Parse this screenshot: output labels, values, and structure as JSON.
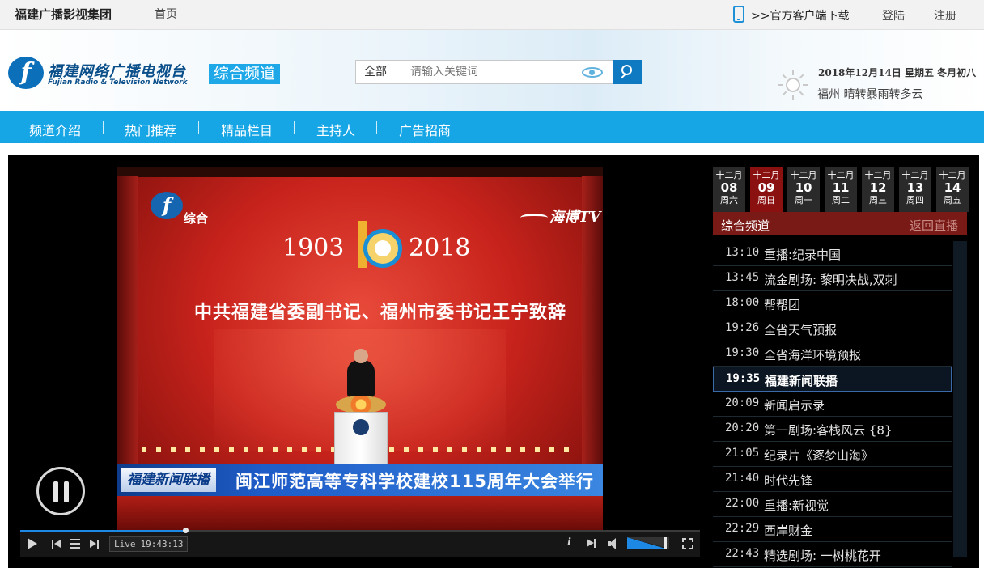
{
  "topbar": {
    "group_name": "福建广播影视集团",
    "home": "首页",
    "download": ">>官方客户端下载",
    "login": "登陆",
    "register": "注册"
  },
  "header": {
    "logo_letter": "f",
    "logo_cn": "福建网络广播电视台",
    "logo_en": "Fujian Radio & Television Network",
    "channel_tag": "综合频道",
    "search": {
      "category": "全部",
      "placeholder": "请输入关键词"
    },
    "date": "2018年12月14日  星期五  冬月初八",
    "weather": "福州 晴转暴雨转多云"
  },
  "nav": {
    "items": [
      "频道介绍",
      "热门推荐",
      "精品栏目",
      "主持人",
      "广告招商"
    ]
  },
  "video": {
    "channel_logo_letter": "f",
    "channel_name": "综合",
    "watermark": "海博TV",
    "year_start": "1903",
    "year_end": "2018",
    "headline": "中共福建省委副书记、福州市委书记王宁致辞",
    "program_tag": "福建新闻联播",
    "news_ticker": "闽江师范高等专科学校建校115周年大会举行"
  },
  "controls": {
    "live_label": "Live",
    "live_time": "19:43:13",
    "info_label": "i",
    "progress": 0.243,
    "volume": 0.92
  },
  "schedule": {
    "days": [
      {
        "month": "十二月",
        "day": "08",
        "weekday": "周六",
        "active": false
      },
      {
        "month": "十二月",
        "day": "09",
        "weekday": "周日",
        "active": true
      },
      {
        "month": "十二月",
        "day": "10",
        "weekday": "周一",
        "active": false
      },
      {
        "month": "十二月",
        "day": "11",
        "weekday": "周二",
        "active": false
      },
      {
        "month": "十二月",
        "day": "12",
        "weekday": "周三",
        "active": false
      },
      {
        "month": "十二月",
        "day": "13",
        "weekday": "周四",
        "active": false
      },
      {
        "month": "十二月",
        "day": "14",
        "weekday": "周五",
        "active": false
      }
    ],
    "channel": "综合频道",
    "back_live": "返回直播",
    "programs": [
      {
        "time": "13:10",
        "title": "重播:纪录中国",
        "current": false
      },
      {
        "time": "13:45",
        "title": "流金剧场: 黎明决战,双刺",
        "current": false
      },
      {
        "time": "18:00",
        "title": "帮帮团",
        "current": false
      },
      {
        "time": "19:26",
        "title": "全省天气预报",
        "current": false
      },
      {
        "time": "19:30",
        "title": "全省海洋环境预报",
        "current": false
      },
      {
        "time": "19:35",
        "title": "福建新闻联播",
        "current": true
      },
      {
        "time": "20:09",
        "title": "新闻启示录",
        "current": false
      },
      {
        "time": "20:20",
        "title": "第一剧场:客栈风云 {8}",
        "current": false
      },
      {
        "time": "21:05",
        "title": "纪录片《逐梦山海》",
        "current": false
      },
      {
        "time": "21:40",
        "title": "时代先锋",
        "current": false
      },
      {
        "time": "22:00",
        "title": "重播:新视觉",
        "current": false
      },
      {
        "time": "22:29",
        "title": "西岸财金",
        "current": false
      },
      {
        "time": "22:43",
        "title": "精选剧场: 一树桃花开",
        "current": false
      }
    ]
  },
  "colors": {
    "nav_bg": "#16a6e6",
    "accent_blue": "#0f7ac2",
    "active_day": "#8b1010",
    "schedule_header": "#7a1a16"
  }
}
